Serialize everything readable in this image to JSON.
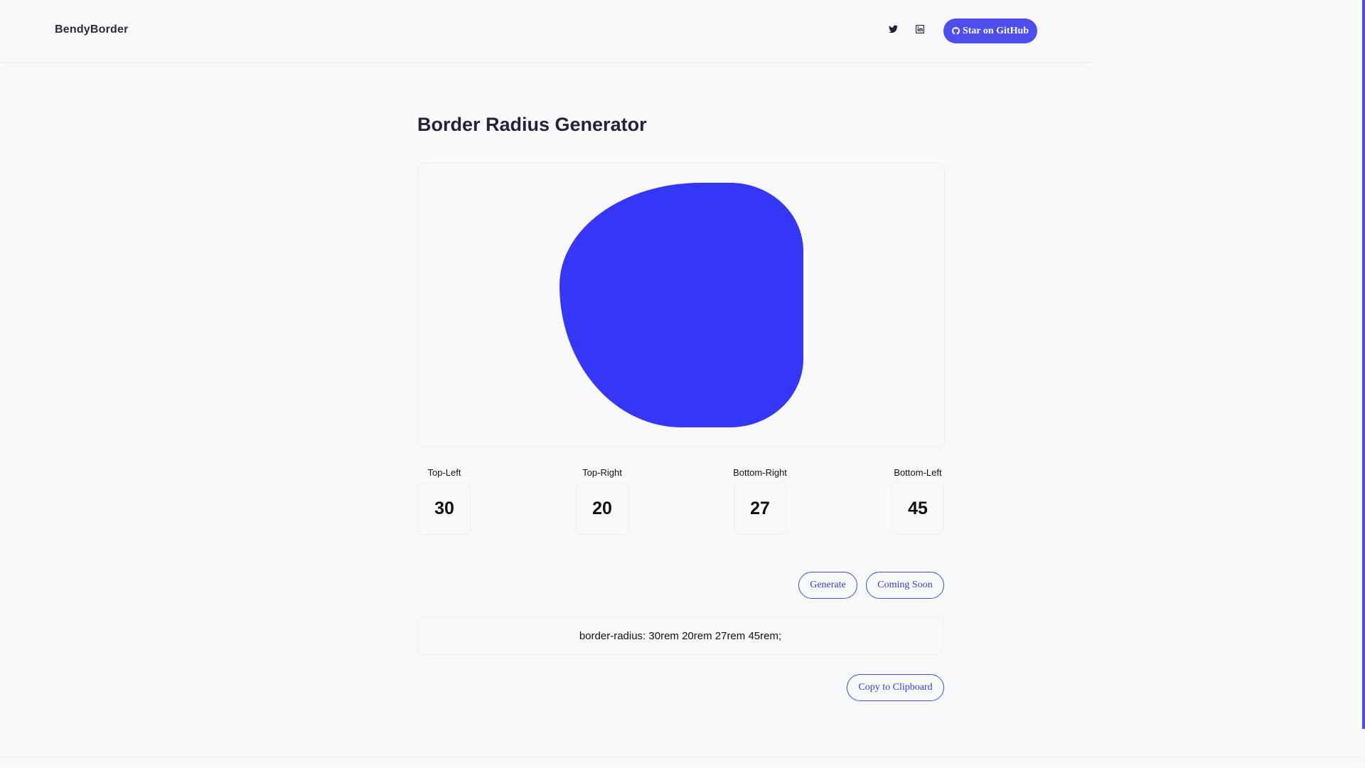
{
  "header": {
    "brand": "BendyBorder",
    "github_label": "Star on GitHub",
    "icons": [
      "twitter-icon",
      "linkedin-icon",
      "github-icon"
    ]
  },
  "main": {
    "title": "Border Radius Generator",
    "corners": [
      {
        "label": "Top-Left",
        "value": "30"
      },
      {
        "label": "Top-Right",
        "value": "20"
      },
      {
        "label": "Bottom-Right",
        "value": "27"
      },
      {
        "label": "Bottom-Left",
        "value": "45"
      }
    ],
    "generate_label": "Generate",
    "coming_soon_label": "Coming Soon",
    "css_output": "border-radius: 30rem 20rem 27rem 45rem;",
    "copy_label": "Copy to Clipboard"
  },
  "colors": {
    "accent": "#4e4ef0",
    "shape": "#3636f7",
    "background": "#f8f9fb"
  }
}
